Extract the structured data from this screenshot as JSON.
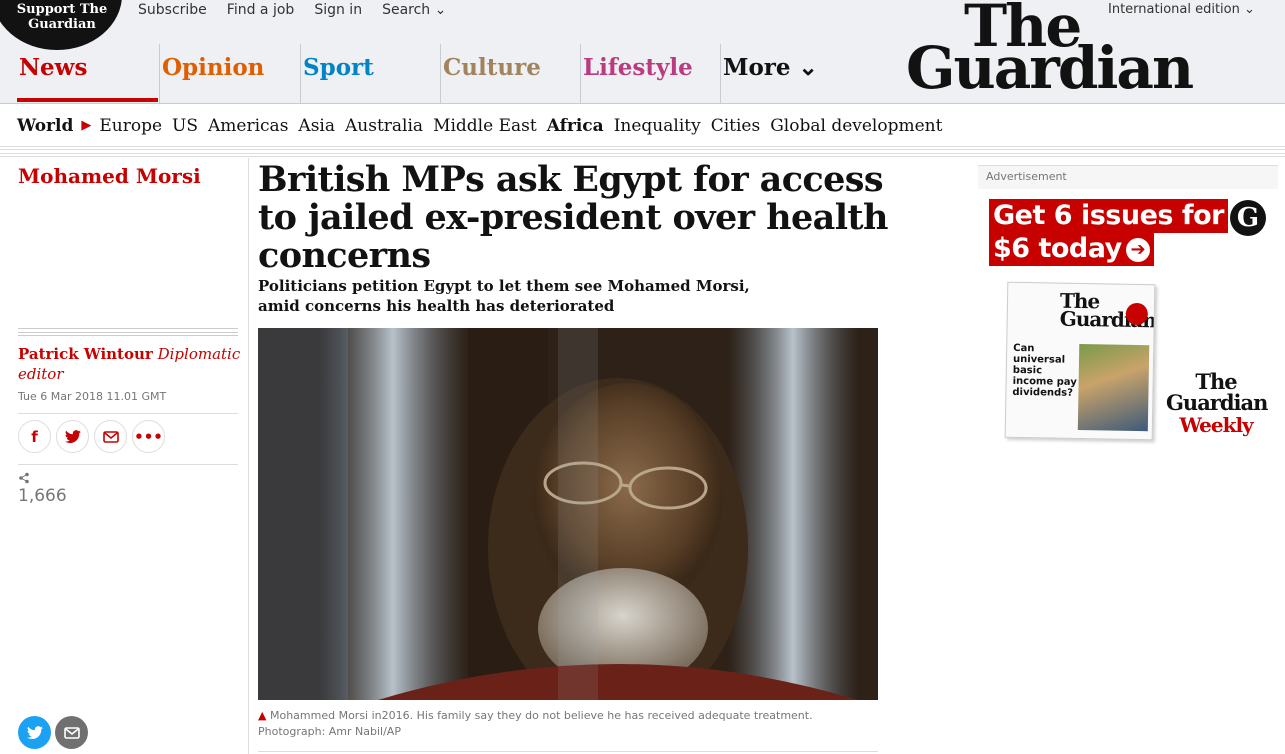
{
  "header": {
    "support": "Support The Guardian",
    "top_links": [
      "Subscribe",
      "Find a job",
      "Sign in",
      "Search ⌄"
    ],
    "edition": "International edition ⌄",
    "logo_line1": "The",
    "logo_line2": "Guardian",
    "pillars": [
      "News",
      "Opinion",
      "Sport",
      "Culture",
      "Lifestyle",
      "More ⌄"
    ]
  },
  "subnav": {
    "section": "World",
    "items": [
      "Europe",
      "US",
      "Americas",
      "Asia",
      "Australia",
      "Middle East",
      "Africa",
      "Inequality",
      "Cities",
      "Global development"
    ]
  },
  "article": {
    "series": "Mohamed Morsi",
    "headline": "British MPs ask Egypt for access to jailed ex-president over health concerns",
    "standfirst": "Politicians petition Egypt to let them see Mohamed Morsi, amid concerns his health has deteriorated",
    "author": "Patrick Wintour",
    "author_role": "Diplomatic editor",
    "date": "Tue 6 Mar 2018 11.01 GMT",
    "share_count": "1,666",
    "caption": "Mohammed Morsi in2016. His family say they do not believe he has received adequate treatment. Photograph: Amr Nabil/AP"
  },
  "share_buttons": [
    "facebook-icon",
    "twitter-icon",
    "email-icon",
    "more-icon"
  ],
  "ad": {
    "label": "Advertisement",
    "line1": "Get 6 issues for",
    "line2": "$6 today",
    "mag_headline": "Can universal basic income pay dividends?",
    "weekly_line1": "The",
    "weekly_line2": "Guardian",
    "weekly_line3": "Weekly"
  },
  "colors": {
    "news": "#c70000",
    "opinion": "#e05e00",
    "sport": "#0084c6",
    "culture": "#a1845c",
    "lifestyle": "#bb3b80"
  }
}
